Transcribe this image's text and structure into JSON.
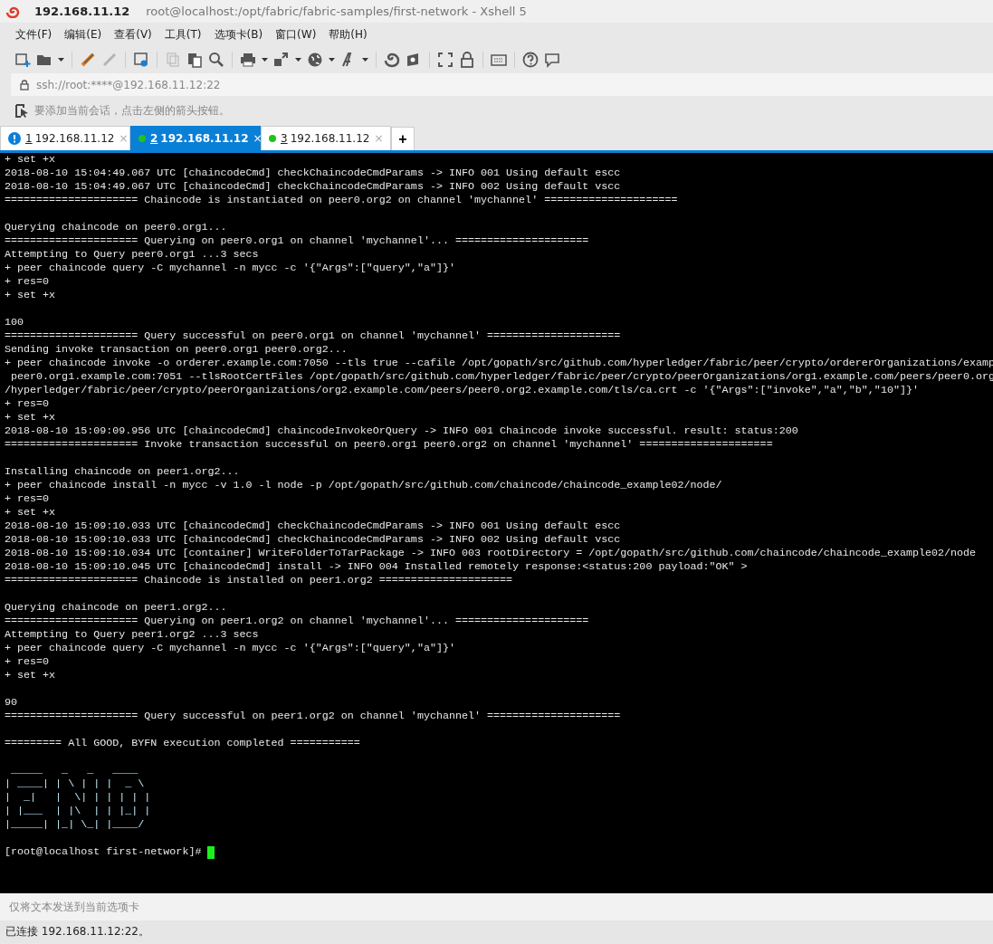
{
  "window": {
    "host": "192.168.11.12",
    "title": "root@localhost:/opt/fabric/fabric-samples/first-network - Xshell 5"
  },
  "menu": [
    "文件(F)",
    "编辑(E)",
    "查看(V)",
    "工具(T)",
    "选项卡(B)",
    "窗口(W)",
    "帮助(H)"
  ],
  "address": "ssh://root:****@192.168.11.12:22",
  "hint": "要添加当前会话，点击左侧的箭头按钮。",
  "tabs": [
    {
      "number": "1",
      "label": "192.168.11.12",
      "kind": "warning",
      "selected": false,
      "close": "×"
    },
    {
      "number": "2",
      "label": "192.168.11.12",
      "kind": "connected",
      "selected": true,
      "close": "×"
    },
    {
      "number": "3",
      "label": "192.168.11.12",
      "kind": "connected",
      "selected": false,
      "close": "×"
    }
  ],
  "add_tab": "+",
  "terminal": {
    "blocks": [
      {
        "kind": "text",
        "lines": [
          "+ set +x",
          "2018-08-10 15:04:49.067 UTC [chaincodeCmd] checkChaincodeCmdParams -> INFO 001 Using default escc",
          "2018-08-10 15:04:49.067 UTC [chaincodeCmd] checkChaincodeCmdParams -> INFO 002 Using default vscc",
          "===================== Chaincode is instantiated on peer0.org2 on channel 'mychannel' ====================="
        ]
      },
      {
        "kind": "text",
        "lines": [
          "Querying chaincode on peer0.org1...",
          "===================== Querying on peer0.org1 on channel 'mychannel'... =====================",
          "Attempting to Query peer0.org1 ...3 secs",
          "+ peer chaincode query -C mychannel -n mycc -c '{\"Args\":[\"query\",\"a\"]}'",
          "+ res=0",
          "+ set +x"
        ]
      },
      {
        "kind": "text",
        "lines": [
          "100",
          "===================== Query successful on peer0.org1 on channel 'mychannel' =====================",
          "Sending invoke transaction on peer0.org1 peer0.org2...",
          "+ peer chaincode invoke -o orderer.example.com:7050 --tls true --cafile /opt/gopath/src/github.com/hyperledger/fabric/peer/crypto/ordererOrganizations/examp",
          " peer0.org1.example.com:7051 --tlsRootCertFiles /opt/gopath/src/github.com/hyperledger/fabric/peer/crypto/peerOrganizations/org1.example.com/peers/peer0.org",
          "/hyperledger/fabric/peer/crypto/peerOrganizations/org2.example.com/peers/peer0.org2.example.com/tls/ca.crt -c '{\"Args\":[\"invoke\",\"a\",\"b\",\"10\"]}'",
          "+ res=0",
          "+ set +x",
          "2018-08-10 15:09:09.956 UTC [chaincodeCmd] chaincodeInvokeOrQuery -> INFO 001 Chaincode invoke successful. result: status:200",
          "===================== Invoke transaction successful on peer0.org1 peer0.org2 on channel 'mychannel' ====================="
        ]
      },
      {
        "kind": "text",
        "lines": [
          "Installing chaincode on peer1.org2...",
          "+ peer chaincode install -n mycc -v 1.0 -l node -p /opt/gopath/src/github.com/chaincode/chaincode_example02/node/",
          "+ res=0",
          "+ set +x",
          "2018-08-10 15:09:10.033 UTC [chaincodeCmd] checkChaincodeCmdParams -> INFO 001 Using default escc",
          "2018-08-10 15:09:10.033 UTC [chaincodeCmd] checkChaincodeCmdParams -> INFO 002 Using default vscc",
          "2018-08-10 15:09:10.034 UTC [container] WriteFolderToTarPackage -> INFO 003 rootDirectory = /opt/gopath/src/github.com/chaincode/chaincode_example02/node",
          "2018-08-10 15:09:10.045 UTC [chaincodeCmd] install -> INFO 004 Installed remotely response:<status:200 payload:\"OK\" >",
          "===================== Chaincode is installed on peer1.org2 ====================="
        ]
      },
      {
        "kind": "text",
        "lines": [
          "Querying chaincode on peer1.org2...",
          "===================== Querying on peer1.org2 on channel 'mychannel'... =====================",
          "Attempting to Query peer1.org2 ...3 secs",
          "+ peer chaincode query -C mychannel -n mycc -c '{\"Args\":[\"query\",\"a\"]}'",
          "+ res=0",
          "+ set +x"
        ]
      },
      {
        "kind": "text",
        "lines": [
          "90",
          "===================== Query successful on peer1.org2 on channel 'mychannel' ====================="
        ]
      },
      {
        "kind": "text",
        "lines": [
          "========= All GOOD, BYFN execution completed ==========="
        ]
      },
      {
        "kind": "art",
        "lines": [
          " _____   _   _   ____  ",
          "| ____| | \\ | | |  _ \\ ",
          "|  _|   |  \\| | | | | |",
          "| |___  | |\\  | | |_| |",
          "|_____| |_| \\_| |____/ "
        ]
      },
      {
        "kind": "prompt",
        "lines": [
          "[root@localhost first-network]# "
        ]
      }
    ]
  },
  "send_placeholder": "仅将文本发送到当前选项卡",
  "status": "已连接 192.168.11.12:22。"
}
